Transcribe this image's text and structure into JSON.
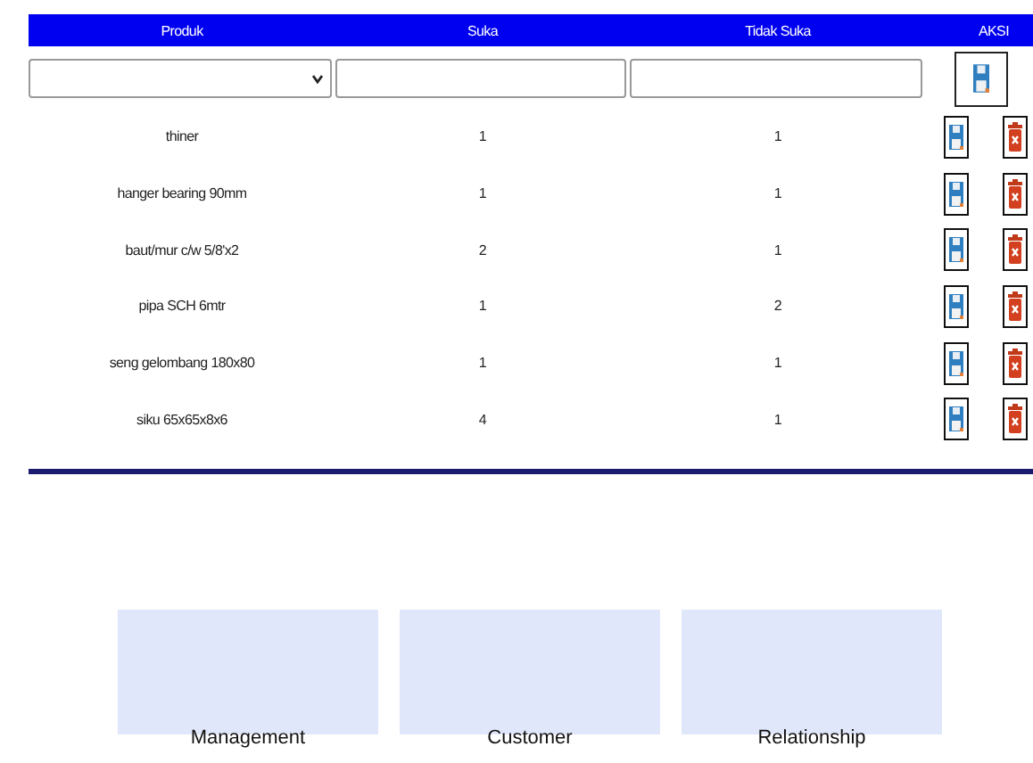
{
  "table": {
    "columns": [
      "Produk",
      "Suka",
      "Tidak Suka",
      "AKSI"
    ],
    "rows": [
      {
        "produk": "thiner",
        "suka": "1",
        "tidak_suka": "1"
      },
      {
        "produk": "hanger bearing 90mm",
        "suka": "1",
        "tidak_suka": "1"
      },
      {
        "produk": "baut/mur c/w 5/8'x2",
        "suka": "2",
        "tidak_suka": "1"
      },
      {
        "produk": "pipa SCH 6mtr",
        "suka": "1",
        "tidak_suka": "2"
      },
      {
        "produk": "seng gelombang 180x80",
        "suka": "1",
        "tidak_suka": "1"
      },
      {
        "produk": "siku 65x65x8x6",
        "suka": "4",
        "tidak_suka": "1"
      }
    ]
  },
  "cards": [
    {
      "label": "Management"
    },
    {
      "label": "Customer"
    },
    {
      "label": "Relationship"
    }
  ]
}
